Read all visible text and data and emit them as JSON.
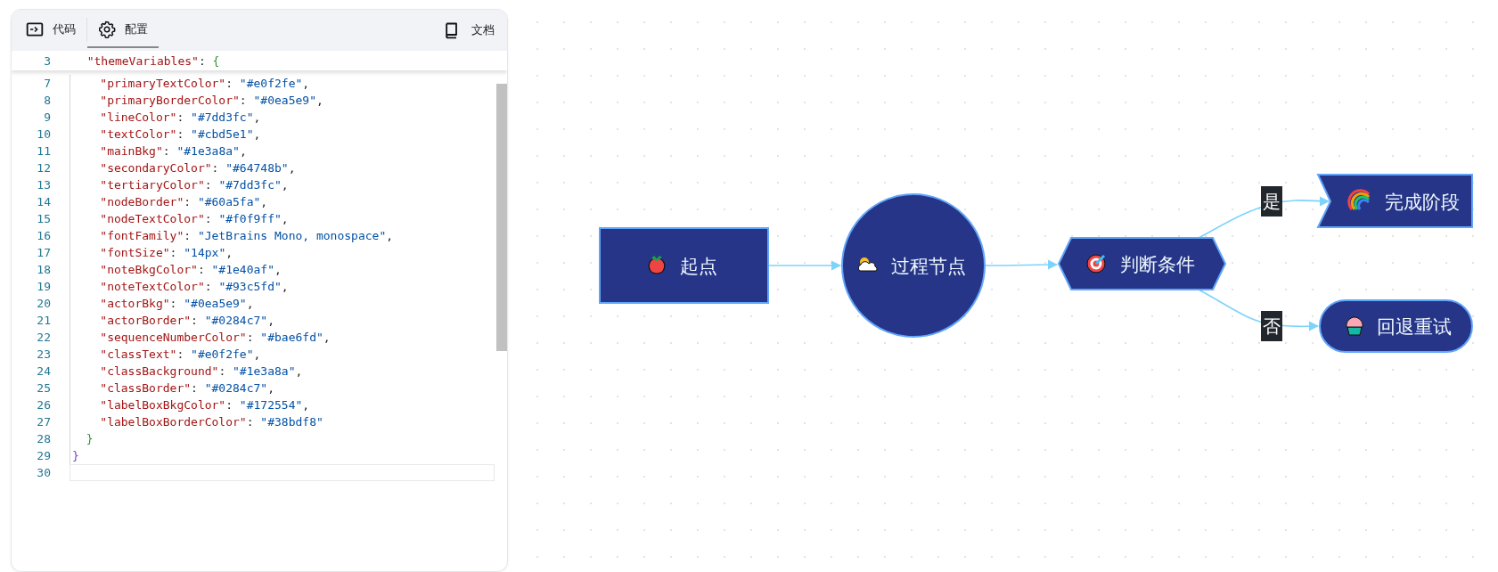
{
  "tabs": [
    {
      "label": "代码",
      "selected": false
    },
    {
      "label": "配置",
      "selected": true
    }
  ],
  "docs_link": "文档",
  "editor": {
    "sticky_line": {
      "number": "3",
      "text": "  \"themeVariables\": {"
    },
    "lines": [
      {
        "number": "7",
        "text": "    \"primaryTextColor\": \"#e0f2fe\",",
        "current": false
      },
      {
        "number": "8",
        "text": "    \"primaryBorderColor\": \"#0ea5e9\",",
        "current": false
      },
      {
        "number": "9",
        "text": "    \"lineColor\": \"#7dd3fc\",",
        "current": false
      },
      {
        "number": "10",
        "text": "    \"textColor\": \"#cbd5e1\",",
        "current": false
      },
      {
        "number": "11",
        "text": "    \"mainBkg\": \"#1e3a8a\",",
        "current": false
      },
      {
        "number": "12",
        "text": "    \"secondaryColor\": \"#64748b\",",
        "current": false
      },
      {
        "number": "13",
        "text": "    \"tertiaryColor\": \"#7dd3fc\",",
        "current": false
      },
      {
        "number": "14",
        "text": "    \"nodeBorder\": \"#60a5fa\",",
        "current": false
      },
      {
        "number": "15",
        "text": "    \"nodeTextColor\": \"#f0f9ff\",",
        "current": false
      },
      {
        "number": "16",
        "text": "    \"fontFamily\": \"JetBrains Mono, monospace\",",
        "current": false
      },
      {
        "number": "17",
        "text": "    \"fontSize\": \"14px\",",
        "current": false
      },
      {
        "number": "18",
        "text": "    \"noteBkgColor\": \"#1e40af\",",
        "current": false
      },
      {
        "number": "19",
        "text": "    \"noteTextColor\": \"#93c5fd\",",
        "current": false
      },
      {
        "number": "20",
        "text": "    \"actorBkg\": \"#0ea5e9\",",
        "current": false
      },
      {
        "number": "21",
        "text": "    \"actorBorder\": \"#0284c7\",",
        "current": false
      },
      {
        "number": "22",
        "text": "    \"sequenceNumberColor\": \"#bae6fd\",",
        "current": false
      },
      {
        "number": "23",
        "text": "    \"classText\": \"#e0f2fe\",",
        "current": false
      },
      {
        "number": "24",
        "text": "    \"classBackground\": \"#1e3a8a\",",
        "current": false
      },
      {
        "number": "25",
        "text": "    \"classBorder\": \"#0284c7\",",
        "current": false
      },
      {
        "number": "26",
        "text": "    \"labelBoxBkgColor\": \"#172554\",",
        "current": false
      },
      {
        "number": "27",
        "text": "    \"labelBoxBorderColor\": \"#38bdf8\"",
        "current": false
      },
      {
        "number": "28",
        "text": "  }",
        "current": false
      },
      {
        "number": "29",
        "text": "}",
        "current": false
      },
      {
        "number": "30",
        "current": true
      }
    ]
  },
  "diagram": {
    "nodes": [
      {
        "kind": "rect",
        "label": "起点"
      },
      {
        "kind": "circle",
        "label": "过程节点"
      },
      {
        "kind": "hexagon",
        "label": "判断条件"
      },
      {
        "kind": "flag",
        "label": "完成阶段"
      },
      {
        "kind": "stadium",
        "label": "回退重试"
      }
    ],
    "edge_labels": [
      "是",
      "否"
    ]
  }
}
